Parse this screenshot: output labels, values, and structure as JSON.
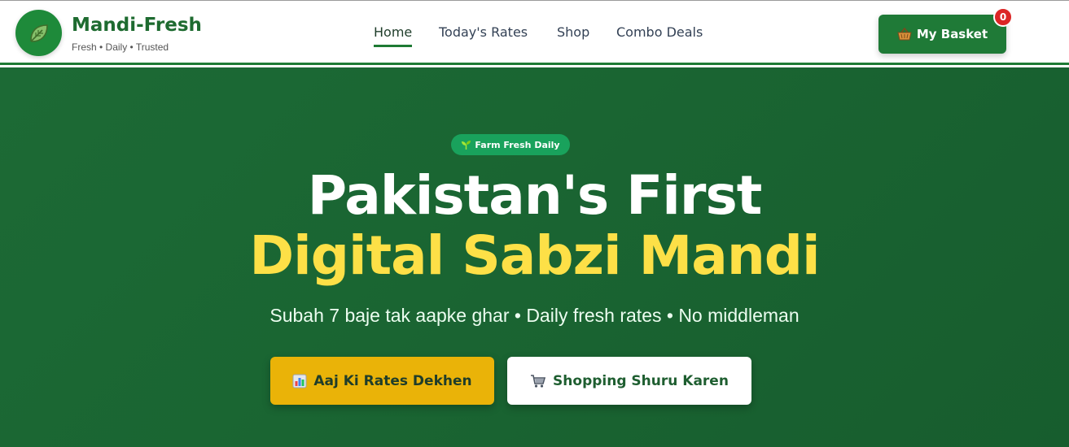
{
  "brand": {
    "name": "Mandi-Fresh",
    "tagline": "Fresh • Daily • Trusted",
    "logo_icon": "leaf-icon"
  },
  "nav": {
    "items": [
      {
        "label": "Home",
        "active": true
      },
      {
        "label": "Today's Rates",
        "active": false
      },
      {
        "label": "Shop",
        "active": false
      },
      {
        "label": "Combo Deals",
        "active": false
      }
    ]
  },
  "basket": {
    "label": "My Basket",
    "count": "0",
    "icon": "basket-icon"
  },
  "hero": {
    "badge": "Farm Fresh Daily",
    "badge_icon": "seedling-icon",
    "title_line1": "Pakistan's First",
    "title_line2": "Digital Sabzi Mandi",
    "subtitle": "Subah 7 baje tak aapke ghar • Daily fresh rates • No middleman",
    "primary_button": {
      "label": "Aaj Ki Rates Dekhen",
      "icon": "bar-chart-icon"
    },
    "secondary_button": {
      "label": "Shopping Shuru Karen",
      "icon": "cart-icon"
    }
  },
  "colors": {
    "brand_green": "#1e7a34",
    "hero_bg": "#1a6532",
    "accent_yellow": "#fde047",
    "button_yellow": "#eab308",
    "badge_red": "#dc2626"
  }
}
